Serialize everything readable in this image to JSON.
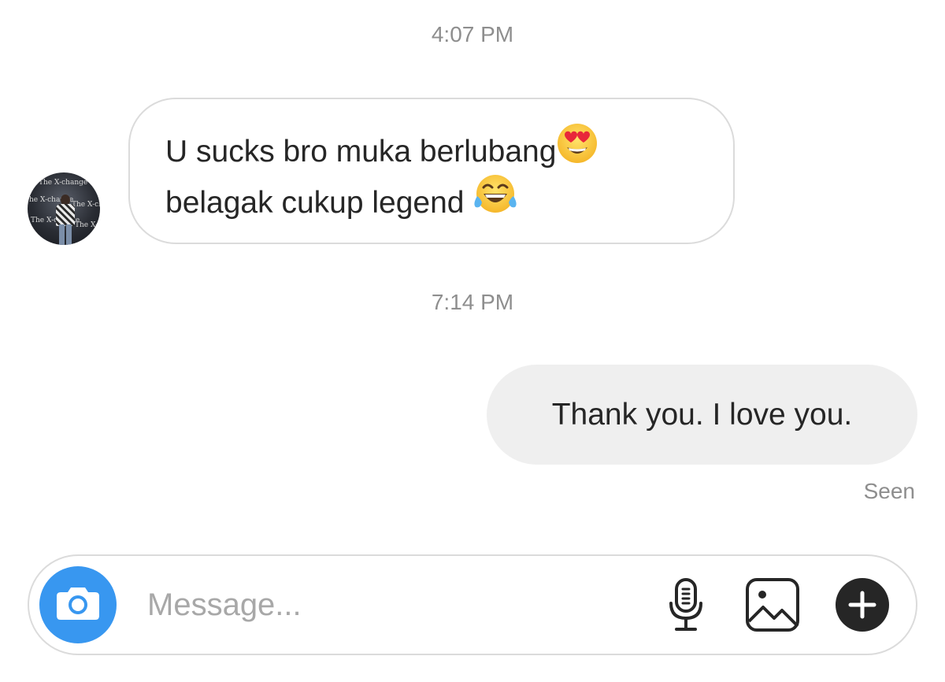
{
  "conversation": {
    "timestamp_1": "4:07 PM",
    "incoming_message": {
      "line_1": "U sucks bro muka berlubang",
      "line_2": "belagak cukup legend ",
      "emoji_1": "heart-eyes-emoji",
      "emoji_2": "tears-of-joy-emoji"
    },
    "avatar_banner_text": "The X-change",
    "timestamp_2": "7:14 PM",
    "outgoing_message": "Thank you. I love you.",
    "seen_label": "Seen"
  },
  "composer": {
    "placeholder": "Message...",
    "camera_icon": "camera-icon",
    "mic_icon": "microphone-icon",
    "gallery_icon": "gallery-icon",
    "plus_icon": "plus-icon"
  },
  "colors": {
    "accent": "#3897f0",
    "text": "#262626",
    "muted": "#8e8e8e",
    "bubble_border": "#dbdbdb",
    "outgoing_bubble": "#efefef"
  }
}
